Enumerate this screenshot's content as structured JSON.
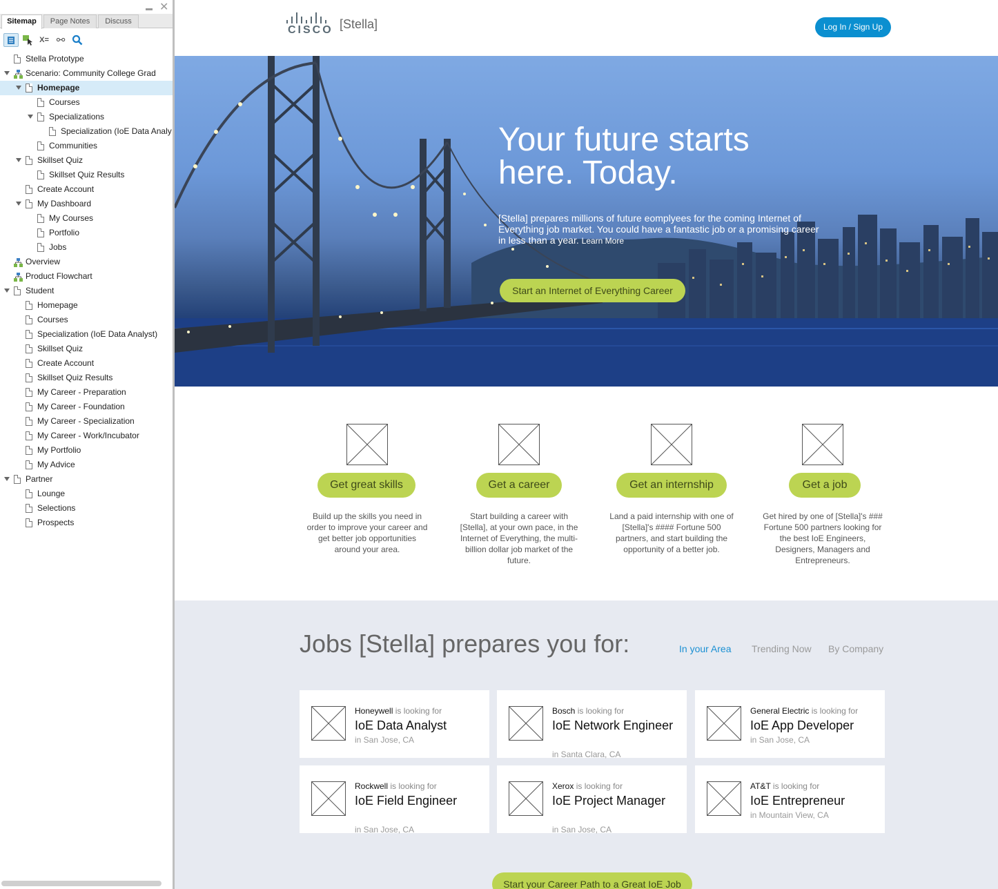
{
  "panel": {
    "tabs": [
      {
        "label": "Sitemap"
      },
      {
        "label": "Page Notes"
      },
      {
        "label": "Discuss"
      }
    ],
    "controls": {
      "minimize": "▬",
      "close": "✕"
    },
    "toolbar": {
      "variables_label": "X=",
      "link_label": "⚯"
    },
    "tree": [
      {
        "label": "Stella Prototype",
        "icon": "page-icon"
      },
      {
        "label": "Scenario: Community College Grad",
        "icon": "flow-icon"
      },
      {
        "label": "Homepage",
        "icon": "page-icon",
        "selected": true
      },
      {
        "label": "Courses",
        "icon": "page-icon"
      },
      {
        "label": "Specializations",
        "icon": "page-icon"
      },
      {
        "label": "Specialization (IoE Data Analy",
        "icon": "page-icon"
      },
      {
        "label": "Communities",
        "icon": "page-icon"
      },
      {
        "label": "Skillset Quiz",
        "icon": "page-icon"
      },
      {
        "label": "Skillset Quiz Results",
        "icon": "page-icon"
      },
      {
        "label": "Create Account",
        "icon": "page-icon"
      },
      {
        "label": "My Dashboard",
        "icon": "page-icon"
      },
      {
        "label": "My Courses",
        "icon": "page-icon"
      },
      {
        "label": "Portfolio",
        "icon": "page-icon"
      },
      {
        "label": "Jobs",
        "icon": "page-icon"
      },
      {
        "label": "Overview",
        "icon": "flow-icon"
      },
      {
        "label": "Product Flowchart",
        "icon": "flow-icon"
      },
      {
        "label": "Student",
        "icon": "page-icon"
      },
      {
        "label": "Homepage",
        "icon": "page-icon"
      },
      {
        "label": "Courses",
        "icon": "page-icon"
      },
      {
        "label": "Specialization (IoE Data Analyst)",
        "icon": "page-icon"
      },
      {
        "label": "Skillset Quiz",
        "icon": "page-icon"
      },
      {
        "label": "Create Account",
        "icon": "page-icon"
      },
      {
        "label": "Skillset Quiz Results",
        "icon": "page-icon"
      },
      {
        "label": "My Career - Preparation",
        "icon": "page-icon"
      },
      {
        "label": "My Career - Foundation",
        "icon": "page-icon"
      },
      {
        "label": "My Career - Specialization",
        "icon": "page-icon"
      },
      {
        "label": "My Career - Work/Incubator",
        "icon": "page-icon"
      },
      {
        "label": "My Portfolio",
        "icon": "page-icon"
      },
      {
        "label": "My Advice",
        "icon": "page-icon"
      },
      {
        "label": "Partner",
        "icon": "page-icon"
      },
      {
        "label": "Lounge",
        "icon": "page-icon"
      },
      {
        "label": "Selections",
        "icon": "page-icon"
      },
      {
        "label": "Prospects",
        "icon": "page-icon"
      }
    ]
  },
  "header": {
    "logo_text": "CISCO",
    "brand": "[Stella]",
    "login_label": "Log In / Sign Up"
  },
  "hero": {
    "title": "Your future starts here. Today.",
    "body": "[Stella] prepares millions of future eomplyees for the coming Internet of Everything job market. You could have a fantastic job or a promising career in less than a year.",
    "learn_more": "Learn More",
    "cta": "Start an Internet of Everything Career"
  },
  "features": [
    {
      "button": "Get great skills",
      "desc": "Build up the skills you need in order to improve your career and get better job opportunities around your area."
    },
    {
      "button": "Get a career",
      "desc": "Start building a career with [Stella], at your own pace, in the Internet of Everything, the multi-billion dollar job market of the future."
    },
    {
      "button": "Get an internship",
      "desc": "Land a paid internship with one of [Stella]'s #### Fortune 500 partners, and start building the opportunity of a better job."
    },
    {
      "button": "Get a job",
      "desc": "Get hired by one of [Stella]'s ### Fortune 500 partners looking for the best IoE Engineers, Designers, Managers and Entrepreneurs."
    }
  ],
  "jobs": {
    "title": "Jobs [Stella] prepares you for:",
    "tabs": [
      {
        "label": "In your Area",
        "active": true
      },
      {
        "label": "Trending Now",
        "active": false
      },
      {
        "label": "By Company",
        "active": false
      }
    ],
    "looking_for": "is looking for",
    "cards": [
      {
        "company": "Honeywell",
        "role": "IoE Data Analyst",
        "location": "in San Jose, CA"
      },
      {
        "company": "Bosch",
        "role": "IoE Network Engineer",
        "location": "in Santa Clara, CA"
      },
      {
        "company": "General Electric",
        "role": "IoE App Developer",
        "location": "in San Jose, CA"
      },
      {
        "company": "Rockwell",
        "role": "IoE Field Engineer",
        "location": "in San Jose, CA"
      },
      {
        "company": "Xerox",
        "role": "IoE Project Manager",
        "location": "in San Jose, CA"
      },
      {
        "company": "AT&T",
        "role": "IoE Entrepreneur",
        "location": "in Mountain View, CA"
      }
    ],
    "cta": "Start your Career Path to a Great IoE Job"
  },
  "colors": {
    "accent_green": "#bcd452",
    "link_blue": "#0b8fd0",
    "selection": "#d6ebf8"
  }
}
